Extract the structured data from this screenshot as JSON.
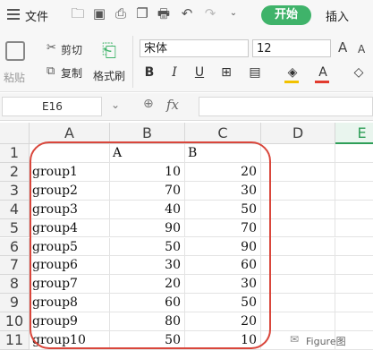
{
  "menu": {
    "file_label": "文件",
    "start_tab": "开始",
    "insert_tab": "插入"
  },
  "clipboard": {
    "paste_label": "粘贴",
    "cut_label": "剪切",
    "copy_label": "复制",
    "format_painter_label": "格式刷"
  },
  "font": {
    "name": "宋体",
    "size": "12",
    "bold": "B",
    "italic": "I",
    "underline": "U",
    "font_color_glyph": "A",
    "grow_glyph": "A",
    "shrink_glyph": "A"
  },
  "formula_bar": {
    "cell_ref": "E16",
    "fx_label": "fx",
    "value": ""
  },
  "columns": [
    "A",
    "B",
    "C",
    "D",
    "E"
  ],
  "rows": [
    {
      "num": "1",
      "a": "",
      "b": "A",
      "c": "B"
    },
    {
      "num": "2",
      "a": "group1",
      "b": "10",
      "c": "20"
    },
    {
      "num": "3",
      "a": "group2",
      "b": "70",
      "c": "30"
    },
    {
      "num": "4",
      "a": "group3",
      "b": "40",
      "c": "50"
    },
    {
      "num": "5",
      "a": "group4",
      "b": "90",
      "c": "70"
    },
    {
      "num": "6",
      "a": "group5",
      "b": "50",
      "c": "90"
    },
    {
      "num": "7",
      "a": "group6",
      "b": "30",
      "c": "60"
    },
    {
      "num": "8",
      "a": "group7",
      "b": "20",
      "c": "30"
    },
    {
      "num": "9",
      "a": "group8",
      "b": "60",
      "c": "50"
    },
    {
      "num": "10",
      "a": "group9",
      "b": "80",
      "c": "20"
    },
    {
      "num": "11",
      "a": "group10",
      "b": "50",
      "c": "10"
    }
  ],
  "watermark": "Figure图",
  "colors": {
    "accent_green": "#3fb36a",
    "highlight_red": "#d9463b",
    "selected_column_green": "#2e9e58"
  }
}
